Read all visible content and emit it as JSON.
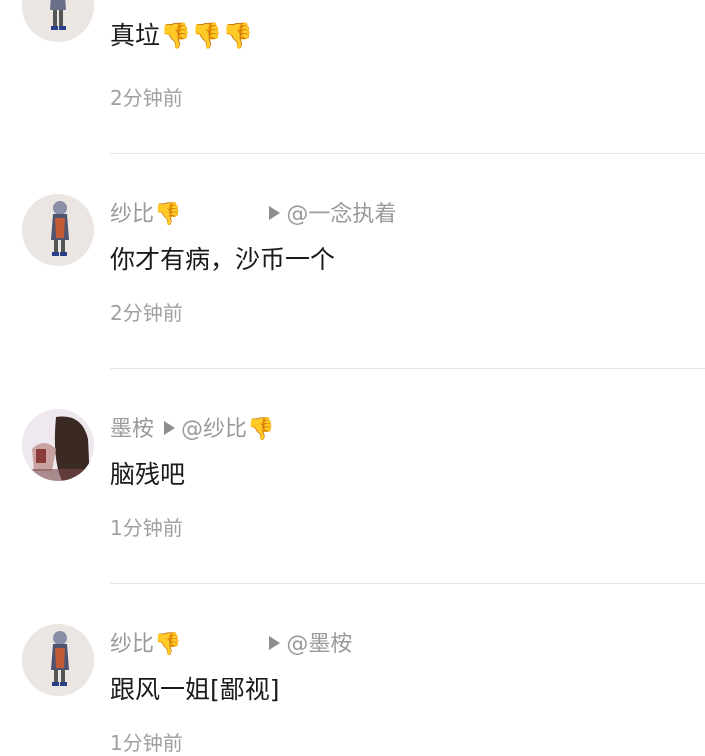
{
  "comments": [
    {
      "id": "c0",
      "text": "真垃👎👎👎",
      "time": "2分钟前"
    },
    {
      "id": "c1",
      "nick": "纱比👎",
      "reply_prefix": "@一念执着",
      "text": "你才有病，沙币一个",
      "time": "2分钟前"
    },
    {
      "id": "c2",
      "nick": "墨桉",
      "reply_prefix": "@纱比👎",
      "text": "脑残吧",
      "time": "1分钟前"
    },
    {
      "id": "c3",
      "nick": "纱比👎",
      "reply_prefix": "@墨桉",
      "text": "跟风一姐[鄙视]",
      "time": "1分钟前"
    }
  ],
  "icons": {
    "reply_arrow": "play-triangle-icon",
    "avatar_a": "anime-character-avatar",
    "avatar_b": "dark-hair-girl-avatar"
  },
  "colors": {
    "name": "#9a9a9a",
    "text": "#1a1a1a",
    "time": "#a0a0a0",
    "divider": "#e6e6e6"
  }
}
